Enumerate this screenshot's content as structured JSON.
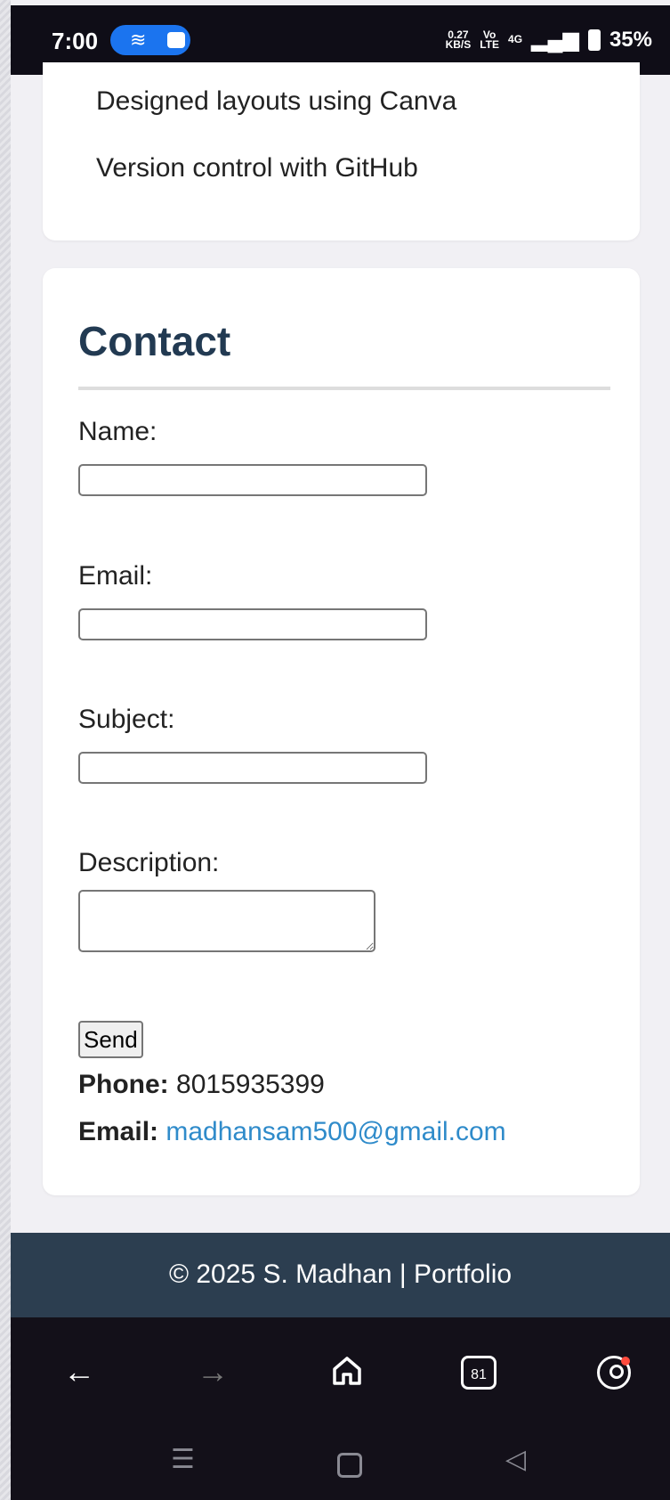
{
  "status_bar": {
    "time": "7:00",
    "net_speed_value": "0.27",
    "net_speed_unit": "KB/S",
    "volte_top": "Vo",
    "volte_bottom": "LTE",
    "network": "4G",
    "battery": "35%"
  },
  "skills_card": {
    "items": [
      "Designed layouts using Canva",
      "Version control with GitHub"
    ]
  },
  "contact": {
    "title": "Contact",
    "name_label": "Name:",
    "email_label": "Email:",
    "subject_label": "Subject:",
    "description_label": "Description:",
    "send_label": "Send",
    "phone_label": "Phone:",
    "phone_value": "8015935399",
    "email_info_label": "Email:",
    "email_value": "madhansam500@gmail.com"
  },
  "footer": {
    "text": "© 2025 S. Madhan | Portfolio"
  },
  "browser_toolbar": {
    "tab_count": "81"
  },
  "colors": {
    "heading": "#223a52",
    "footer_bg": "#2c3e50",
    "link": "#2f8bca",
    "pill": "#1b74ef"
  }
}
